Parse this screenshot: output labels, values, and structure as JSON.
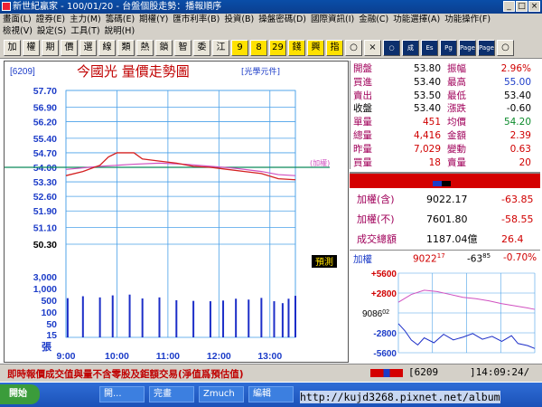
{
  "window": {
    "title": "新世紀贏家 - 100/01/20 - 台盤個股走勢：播報順序"
  },
  "menu": {
    "row1": [
      "畫面(L)",
      "證券(E)",
      "主力(M)",
      "籌碼(E)",
      "期權(Y)",
      "匯市利率(B)",
      "投資(B)",
      "操盤密碼(D)",
      "國際資訊(I)",
      "金融(C)",
      "功能選擇(A)",
      "功能操作(F)"
    ],
    "row2": [
      "檢視(V)",
      "設定(S)",
      "工具(T)",
      "說明(H)"
    ]
  },
  "toolbar": [
    "加",
    "權",
    "期",
    "價",
    "選",
    "線",
    "類",
    "熱",
    "鎖",
    "智",
    "委",
    "江",
    "9",
    "8",
    "29",
    "錢",
    "興",
    "指",
    "○",
    "×",
    "○",
    "成",
    "Es",
    "Pg",
    "Page",
    "Page",
    "○"
  ],
  "chart_data": {
    "type": "line",
    "title": "今國光  量價走勢圖",
    "stock_code": "[6209]",
    "unit_note": "[光學元件]",
    "price_ticks": [
      "57.70",
      "56.90",
      "56.20",
      "55.40",
      "54.70",
      "54.00",
      "53.30",
      "52.60",
      "51.90",
      "51.10",
      "50.30"
    ],
    "price_range": [
      50.3,
      57.7
    ],
    "reference_price": 54.0,
    "reference_label": "(加權)",
    "volume_ticks": [
      "3,000",
      "1,000",
      "500",
      "100",
      "50",
      "15"
    ],
    "volume_unit": "張",
    "x_ticks": [
      "9:00",
      "10:00",
      "11:00",
      "12:00",
      "13:00"
    ],
    "x_range_minutes": [
      0,
      270
    ],
    "tag_label": "預測",
    "price_series": [
      [
        0,
        53.6
      ],
      [
        20,
        53.8
      ],
      [
        40,
        54.1
      ],
      [
        50,
        54.5
      ],
      [
        60,
        54.7
      ],
      [
        80,
        54.7
      ],
      [
        90,
        54.4
      ],
      [
        110,
        54.3
      ],
      [
        130,
        54.2
      ],
      [
        150,
        54.05
      ],
      [
        170,
        54.0
      ],
      [
        190,
        53.9
      ],
      [
        210,
        53.8
      ],
      [
        230,
        53.7
      ],
      [
        250,
        53.45
      ],
      [
        270,
        53.4
      ]
    ],
    "avg_series": [
      [
        0,
        53.9
      ],
      [
        40,
        54.05
      ],
      [
        80,
        54.15
      ],
      [
        110,
        54.2
      ],
      [
        140,
        54.15
      ],
      [
        170,
        54.05
      ],
      [
        200,
        53.95
      ],
      [
        230,
        53.8
      ],
      [
        250,
        53.65
      ],
      [
        270,
        53.6
      ]
    ],
    "volumes": [
      [
        2,
        400
      ],
      [
        20,
        480
      ],
      [
        40,
        430
      ],
      [
        55,
        520
      ],
      [
        75,
        560
      ],
      [
        90,
        390
      ],
      [
        110,
        430
      ],
      [
        130,
        330
      ],
      [
        150,
        310
      ],
      [
        170,
        300
      ],
      [
        185,
        320
      ],
      [
        200,
        380
      ],
      [
        215,
        350
      ],
      [
        230,
        410
      ],
      [
        245,
        300
      ],
      [
        255,
        250
      ],
      [
        262,
        380
      ],
      [
        270,
        500
      ]
    ],
    "colors": {
      "price": "#d42020",
      "avg": "#d050c0",
      "ref": "#0a8a5a",
      "volume": "#1c2ec8",
      "grid": "#4aa0e8",
      "tick": "#1c3cc8"
    }
  },
  "quote": [
    {
      "l1": "開盤",
      "v1": "53.80",
      "c1": "vblack",
      "l2": "振幅",
      "v2": "2.96%",
      "c2": "vred"
    },
    {
      "l1": "買進",
      "v1": "53.40",
      "c1": "vblack",
      "l2": "最高",
      "v2": "55.00",
      "c2": "vblue"
    },
    {
      "l1": "賣出",
      "v1": "53.50",
      "c1": "vblack",
      "l2": "最低",
      "v2": "53.40",
      "c2": "vblack"
    },
    {
      "l1": "收盤",
      "v1": "53.40",
      "c1": "vblack",
      "l2": "漲跌",
      "v2": "-0.60",
      "c2": "vblack"
    },
    {
      "l1": "單量",
      "v1": "451",
      "c1": "vred",
      "l2": "均價",
      "v2": "54.20",
      "c2": "vgreen"
    },
    {
      "l1": "總量",
      "v1": "4,416",
      "c1": "vred",
      "l2": "金額",
      "v2": "2.39",
      "c2": "vred"
    },
    {
      "l1": "昨量",
      "v1": "7,029",
      "c1": "vred",
      "l2": "變動",
      "v2": "0.63",
      "c2": "vred"
    },
    {
      "l1": "買量",
      "v1": "18",
      "c1": "vred",
      "l2": "賣量",
      "v2": "20",
      "c2": "vred"
    }
  ],
  "index": [
    {
      "label": "加權(含)",
      "value": "9022.17",
      "change": "-63.85"
    },
    {
      "label": "加權(不)",
      "value": "7601.80",
      "change": "-58.55"
    },
    {
      "label": "成交總額",
      "value": "1187.04億",
      "change": "26.4"
    }
  ],
  "mini": {
    "label": "加權",
    "value": "9022",
    "value_sup": "17",
    "change": "-63",
    "change_sup": "85",
    "pct": "-0.70%",
    "ticks": [
      "+5600",
      "+2800",
      "908602",
      "-2800",
      "-5600"
    ],
    "ticks_chart": [
      "+5600",
      "+2800",
      "-2800",
      "-5600"
    ],
    "ref_label": "9086",
    "ref_sup": "02",
    "line_series": [
      [
        0,
        -1500
      ],
      [
        10,
        -2500
      ],
      [
        20,
        -3800
      ],
      [
        30,
        -4500
      ],
      [
        40,
        -3500
      ],
      [
        55,
        -4200
      ],
      [
        70,
        -3000
      ],
      [
        85,
        -3800
      ],
      [
        100,
        -3400
      ],
      [
        115,
        -2900
      ],
      [
        130,
        -3700
      ],
      [
        145,
        -3300
      ],
      [
        160,
        -4000
      ],
      [
        175,
        -3200
      ],
      [
        185,
        -4300
      ],
      [
        200,
        -4600
      ],
      [
        211,
        -5000
      ]
    ],
    "avg_series": [
      [
        0,
        1500
      ],
      [
        20,
        2600
      ],
      [
        40,
        3200
      ],
      [
        60,
        3000
      ],
      [
        80,
        2600
      ],
      [
        100,
        2200
      ],
      [
        120,
        2000
      ],
      [
        140,
        1700
      ],
      [
        160,
        1300
      ],
      [
        180,
        1000
      ],
      [
        200,
        700
      ],
      [
        211,
        500
      ]
    ]
  },
  "bottom": {
    "notice": "即時報價成交值與量不含零股及鉅額交易(淨值爲預估值)",
    "code": "[6209",
    "clock": "]14:09:24/"
  },
  "taskbar": {
    "start": "開始",
    "tasks": [
      "開...",
      "完畫",
      "Zmuch",
      "編輯"
    ]
  },
  "watermark": "http://kujd3268.pixnet.net/album"
}
